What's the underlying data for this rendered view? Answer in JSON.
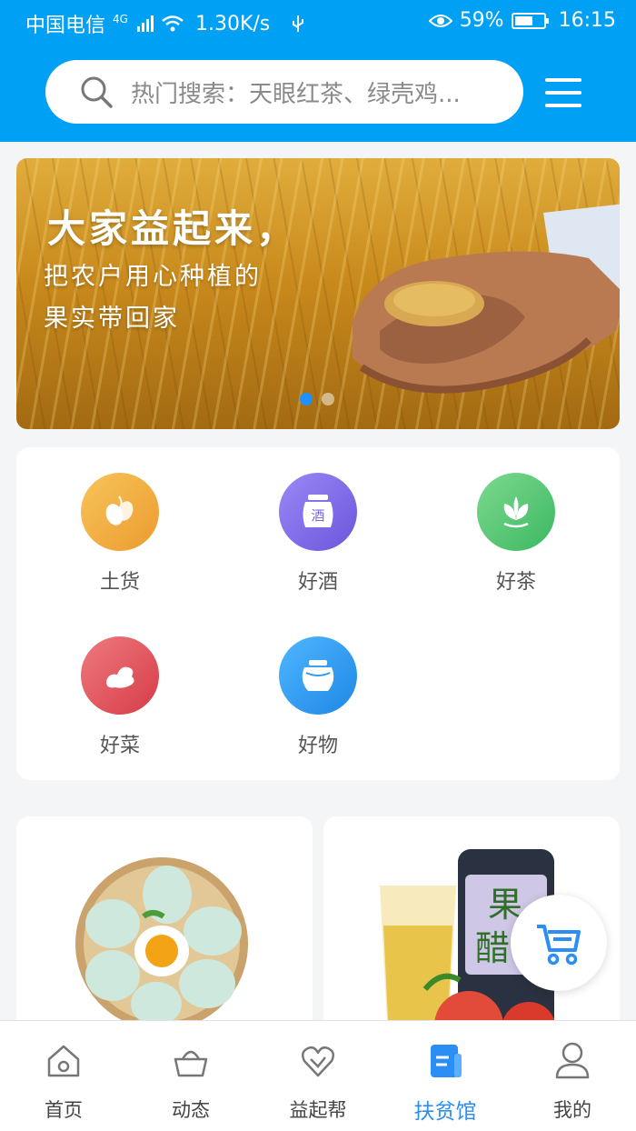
{
  "status_bar": {
    "carrier": "中国电信",
    "network": "4G",
    "speed": "1.30K/s",
    "battery": "59%",
    "time": "16:15"
  },
  "header": {
    "search_placeholder": "热门搜索：天眼红茶、绿壳鸡...",
    "icons": {
      "search": "search-icon",
      "menu": "hamburger-menu-icon"
    }
  },
  "banner": {
    "title": "大家益起来，",
    "line1": "把农户用心种植的",
    "line2": "果实带回家",
    "slide_count": 2,
    "active_slide": 1
  },
  "categories": [
    {
      "label": "土货",
      "icon": "olive-icon",
      "color": "#f0a83a"
    },
    {
      "label": "好酒",
      "icon": "wine-jar-icon",
      "color": "#7b68e6"
    },
    {
      "label": "好茶",
      "icon": "tea-leaf-icon",
      "color": "#4cc56f"
    },
    {
      "label": "好菜",
      "icon": "ginger-icon",
      "color": "#e0505a"
    },
    {
      "label": "好物",
      "icon": "pot-icon",
      "color": "#2c9bf0"
    }
  ],
  "products": [
    {
      "image": "green-eggs-basket-image"
    },
    {
      "image": "fruit-vinegar-drink-image"
    }
  ],
  "cart_fab": {
    "icon": "cart-icon"
  },
  "tabbar": {
    "items": [
      {
        "label": "首页",
        "icon": "home-icon"
      },
      {
        "label": "动态",
        "icon": "basket-icon"
      },
      {
        "label": "益起帮",
        "icon": "heart-icon"
      },
      {
        "label": "扶贫馆",
        "icon": "shop-icon"
      },
      {
        "label": "我的",
        "icon": "user-icon"
      }
    ],
    "active_index": 3,
    "active_color": "#2a8ef5"
  }
}
